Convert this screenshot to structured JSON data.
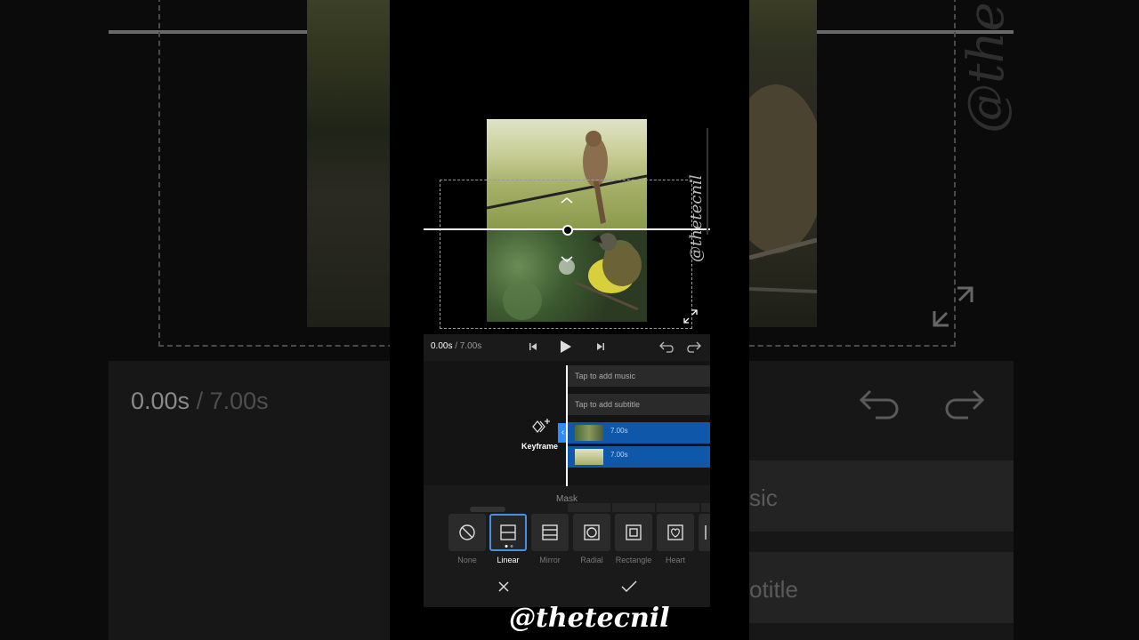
{
  "player": {
    "current_time": "0.00s",
    "total_time": " / 7.00s"
  },
  "timeline": {
    "music_prompt": "Tap to add music",
    "subtitle_prompt": "Tap to add subtitle",
    "clips": [
      {
        "duration": "7.00s"
      },
      {
        "duration": "7.00s"
      }
    ],
    "keyframe_label": "Keyframe"
  },
  "mask_panel": {
    "title": "Mask",
    "options": [
      {
        "label": "None",
        "icon": "none-circle-icon",
        "selected": false
      },
      {
        "label": "Linear",
        "icon": "linear-mask-icon",
        "selected": true
      },
      {
        "label": "Mirror",
        "icon": "mirror-mask-icon",
        "selected": false
      },
      {
        "label": "Radial",
        "icon": "radial-mask-icon",
        "selected": false
      },
      {
        "label": "Rectangle",
        "icon": "rectangle-mask-icon",
        "selected": false
      },
      {
        "label": "Heart",
        "icon": "heart-mask-icon",
        "selected": false
      }
    ]
  },
  "background": {
    "time_current": "0.00s",
    "time_total": " / 7.00s",
    "music_fragment": "sic",
    "subtitle_fragment": "otitle"
  },
  "watermark": "@thetecnil",
  "colors": {
    "accent": "#4a8fe0",
    "clip": "#0f57a8",
    "panel": "#1a1a1a"
  }
}
